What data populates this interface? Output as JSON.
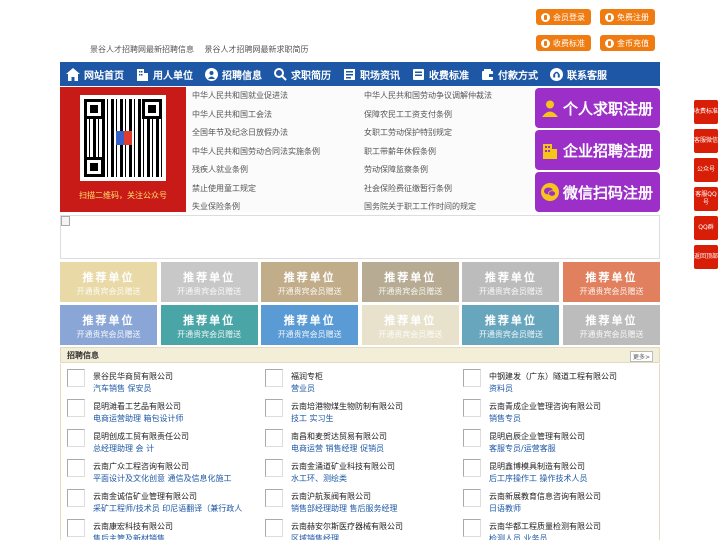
{
  "top_links": [
    "景谷人才招聘网最新招聘信息",
    "景谷人才招聘网最新求职简历"
  ],
  "top_buttons": {
    "member_login": "会员登录",
    "free_register": "免费注册",
    "fee_standard": "收费标准",
    "coin_recharge": "金币充值"
  },
  "nav": [
    "网站首页",
    "用人单位",
    "招聘信息",
    "求职简历",
    "职场资讯",
    "收费标准",
    "付款方式",
    "联系客服"
  ],
  "qr_caption": "扫描二维码，关注公众号",
  "laws": [
    [
      "中华人民共和国就业促进法",
      "中华人民共和国劳动争议调解仲裁法"
    ],
    [
      "中华人民共和国工会法",
      "保障农民工工资支付条例"
    ],
    [
      "全国年节及纪念日放假办法",
      "女职工劳动保护特别规定"
    ],
    [
      "中华人民共和国劳动合同法实施条例",
      "职工带薪年休假条例"
    ],
    [
      "残疾人就业条例",
      "劳动保障监察条例"
    ],
    [
      "禁止使用童工规定",
      "社会保险费征缴暂行条例"
    ],
    [
      "失业保险条例",
      "国务院关于职工工作时间的规定"
    ]
  ],
  "register": {
    "jobseeker": "个人求职注册",
    "company": "企业招聘注册",
    "wechat": "微信扫码注册"
  },
  "recommend": {
    "title": "推荐单位",
    "sub": "开通贵宾会员赠送"
  },
  "jobs_title": "招聘信息",
  "more": "更多>",
  "jobs": [
    [
      {
        "company": "景谷民华商贸有限公司",
        "positions": "汽车销售 保安员"
      },
      {
        "company": "福润专柜",
        "positions": "营业员"
      },
      {
        "company": "中钢建发（广东）隧道工程有限公司",
        "positions": "资料员"
      }
    ],
    [
      {
        "company": "昆明滩看工艺品有限公司",
        "positions": "电商运营助理 箱包设计师"
      },
      {
        "company": "云南培港物煤生物防制有限公司",
        "positions": "技工 实习生"
      },
      {
        "company": "云南青成企业管理咨询有限公司",
        "positions": "销售专员"
      }
    ],
    [
      {
        "company": "昆明创成工贸有限责任公司",
        "positions": "总经理助理 会 计"
      },
      {
        "company": "南昌和麦贺达贸易有限公司",
        "positions": "电商运营 销售经理 促销员"
      },
      {
        "company": "昆明启辰企业管理有限公司",
        "positions": "客服专员/运营客服"
      }
    ],
    [
      {
        "company": "云南广众工程咨询有限公司",
        "positions": "平面设计及文化创意 通信及信息化施工"
      },
      {
        "company": "云南金涌道矿业科技有限公司",
        "positions": "水工环、测绘类"
      },
      {
        "company": "昆明鑫博模具制造有限公司",
        "positions": "后工序操作工 操作技术人员"
      }
    ],
    [
      {
        "company": "云南金诚信矿业管理有限公司",
        "positions": "采矿工程师/技术员 印尼语翻译（兼行政人"
      },
      {
        "company": "云南沪航泵阀有限公司",
        "positions": "销售部经理助理 售后服务经理"
      },
      {
        "company": "云南新展教育信息咨询有限公司",
        "positions": "日语教师"
      }
    ],
    [
      {
        "company": "云南康宏科技有限公司",
        "positions": "售后主管及新材销售"
      },
      {
        "company": "云南赫安尔斯医疗器械有限公司",
        "positions": "区域销售经理"
      },
      {
        "company": "云南华都工程质量检测有限公司",
        "positions": "检测人员 业务员"
      }
    ]
  ],
  "side": [
    "收费标准",
    "客服微信",
    "公众号",
    "客服QQ号",
    "QQ群",
    "返回顶部"
  ],
  "colors": {
    "nav": "#1d57a6",
    "orange": "#f07c11",
    "purple": "#9b2fc7",
    "red": "#d81e06",
    "cells": [
      "#e8d9a6",
      "#c8c8c8",
      "#c2ad8b",
      "#b7ab93",
      "#bcbcbc",
      "#e1805e",
      "#8aa6d6",
      "#4aa5a6",
      "#5b9bd5",
      "#e8e2cc",
      "#67a6bd",
      "#bcbcbc"
    ]
  }
}
